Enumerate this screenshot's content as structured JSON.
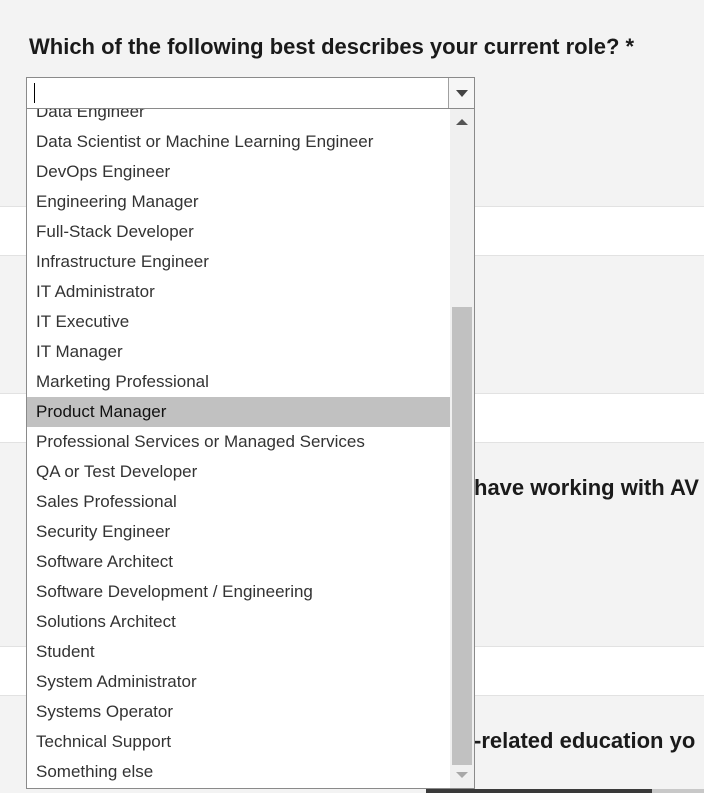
{
  "question": {
    "text": "Which of the following best describes your current role? *"
  },
  "background_questions": [
    {
      "partial_text": "have working with AV"
    },
    {
      "partial_text": "-related education yo"
    }
  ],
  "combobox": {
    "value": "",
    "placeholder": "",
    "expand_icon": "chevron-down-icon"
  },
  "dropdown": {
    "options": [
      "Data Engineer",
      "Data Scientist or Machine Learning Engineer",
      "DevOps Engineer",
      "Engineering Manager",
      "Full-Stack Developer",
      "Infrastructure Engineer",
      "IT Administrator",
      "IT Executive",
      "IT Manager",
      "Marketing Professional",
      "Product Manager",
      "Professional Services or Managed Services",
      "QA or Test Developer",
      "Sales Professional",
      "Security Engineer",
      "Software Architect",
      "Software Development / Engineering",
      "Solutions Architect",
      "Student",
      "System Administrator",
      "Systems Operator",
      "Technical Support",
      "Something else"
    ],
    "highlighted": "Product Manager",
    "scrollbar": {
      "up_icon": "scroll-up-arrow-icon",
      "down_icon": "scroll-down-arrow-icon"
    }
  },
  "colors": {
    "page_band": "#f3f3f3",
    "highlight": "#c1c1c1",
    "scroll_thumb": "#c1c1c1",
    "text": "#333333"
  }
}
